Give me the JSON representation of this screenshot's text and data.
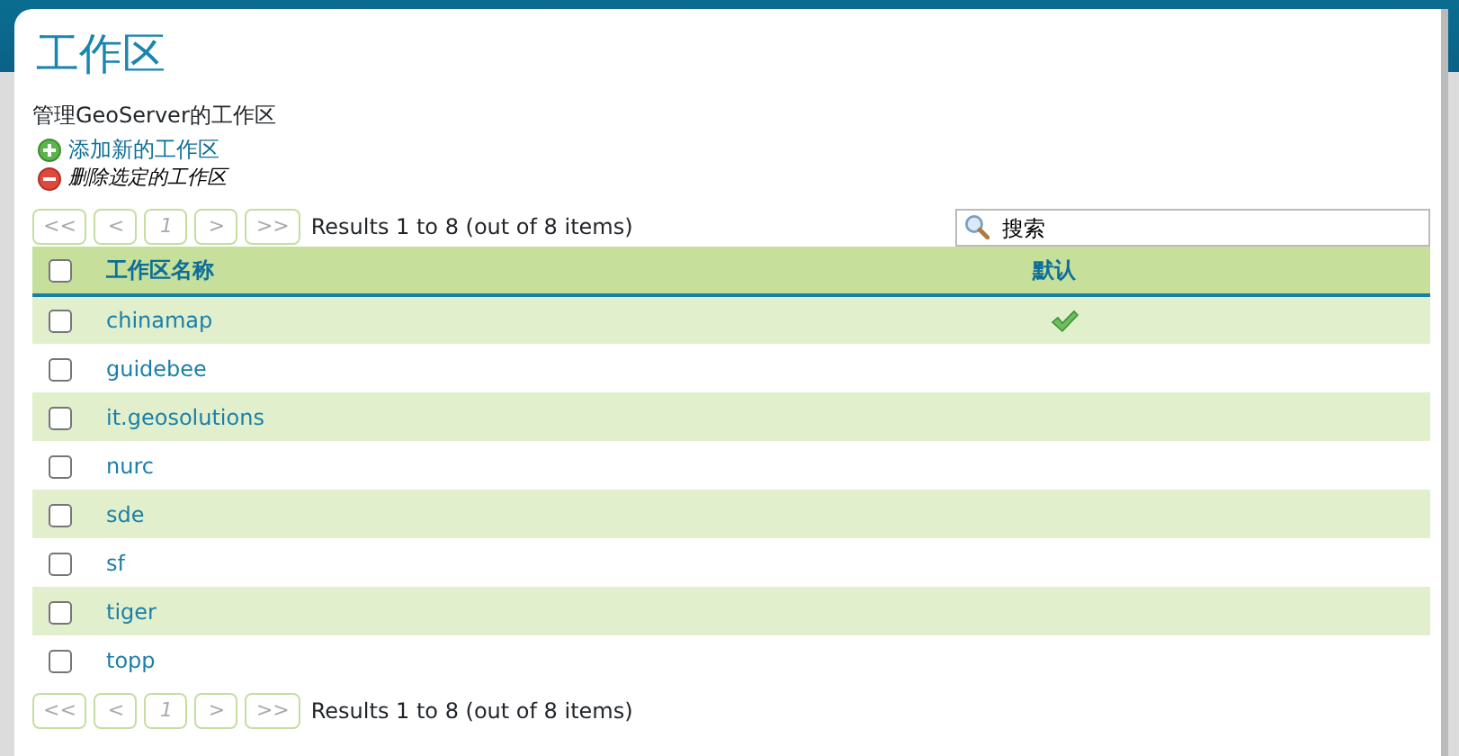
{
  "title": "工作区",
  "description": "管理GeoServer的工作区",
  "actions": [
    {
      "kind": "add",
      "label": "添加新的工作区",
      "disabled": false
    },
    {
      "kind": "remove",
      "label": "删除选定的工作区",
      "disabled": true
    }
  ],
  "pager_top": {
    "buttons": [
      {
        "label": "<<",
        "disabled": true
      },
      {
        "label": "<",
        "disabled": true
      },
      {
        "label": "1",
        "disabled": true
      },
      {
        "label": ">",
        "disabled": true
      },
      {
        "label": ">>",
        "disabled": true
      }
    ],
    "results": "Results 1 to 8 (out of 8 items)"
  },
  "search": {
    "placeholder": "搜索"
  },
  "table": {
    "select_all_checked": false,
    "columns": [
      "工作区名称",
      "默认"
    ],
    "rows": [
      {
        "name": "chinamap",
        "default": true,
        "checked": false
      },
      {
        "name": "guidebee",
        "default": false,
        "checked": false
      },
      {
        "name": "it.geosolutions",
        "default": false,
        "checked": false
      },
      {
        "name": "nurc",
        "default": false,
        "checked": false
      },
      {
        "name": "sde",
        "default": false,
        "checked": false
      },
      {
        "name": "sf",
        "default": false,
        "checked": false
      },
      {
        "name": "tiger",
        "default": false,
        "checked": false
      },
      {
        "name": "topp",
        "default": false,
        "checked": false
      }
    ]
  },
  "pager_bottom": {
    "buttons": [
      {
        "label": "<<",
        "disabled": true
      },
      {
        "label": "<",
        "disabled": true
      },
      {
        "label": "1",
        "disabled": true
      },
      {
        "label": ">",
        "disabled": true
      },
      {
        "label": ">>",
        "disabled": true
      }
    ],
    "results": "Results 1 to 8 (out of 8 items)"
  }
}
